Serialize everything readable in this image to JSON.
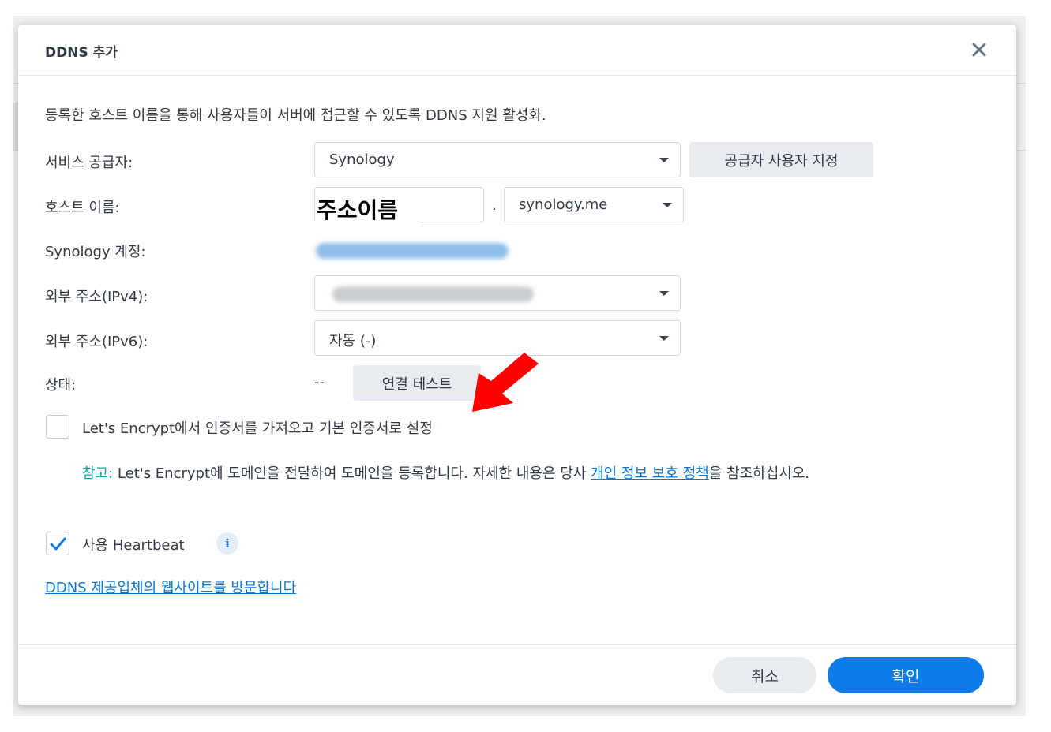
{
  "dialog": {
    "title": "DDNS 추가",
    "description": "등록한 호스트 이름을 통해 사용자들이 서버에 접근할 수 있도록 DDNS 지원 활성화."
  },
  "form": {
    "provider": {
      "label": "서비스 공급자:",
      "value": "Synology",
      "custom_button": "공급자 사용자 지정"
    },
    "hostname": {
      "label": "호스트 이름:",
      "value": "주소이름",
      "separator": ".",
      "domain": "synology.me"
    },
    "account": {
      "label": "Synology 계정:"
    },
    "ipv4": {
      "label": "외부 주소(IPv4):"
    },
    "ipv6": {
      "label": "외부 주소(IPv6):",
      "value": "자동 (-)"
    },
    "status": {
      "label": "상태:",
      "value": "--",
      "test_button": "연결 테스트"
    }
  },
  "options": {
    "letsencrypt": {
      "label": "Let's Encrypt에서 인증서를 가져오고 기본 인증서로 설정",
      "checked": false
    },
    "note": {
      "tag": "참고:",
      "text_before": " Let's Encrypt에 도메인을 전달하여 도메인을 등록합니다. 자세한 내용은 당사 ",
      "link": "개인 정보 보호 정책",
      "text_after": "을 참조하십시오."
    },
    "heartbeat": {
      "label": "사용 Heartbeat",
      "checked": true
    }
  },
  "visit_link": "DDNS 제공업체의 웹사이트를 방문합니다",
  "footer": {
    "cancel": "취소",
    "ok": "확인"
  },
  "colors": {
    "primary": "#0f7be8",
    "link": "#0a77d4",
    "note_tag": "#11a8a0",
    "arrow": "#ff0000"
  }
}
